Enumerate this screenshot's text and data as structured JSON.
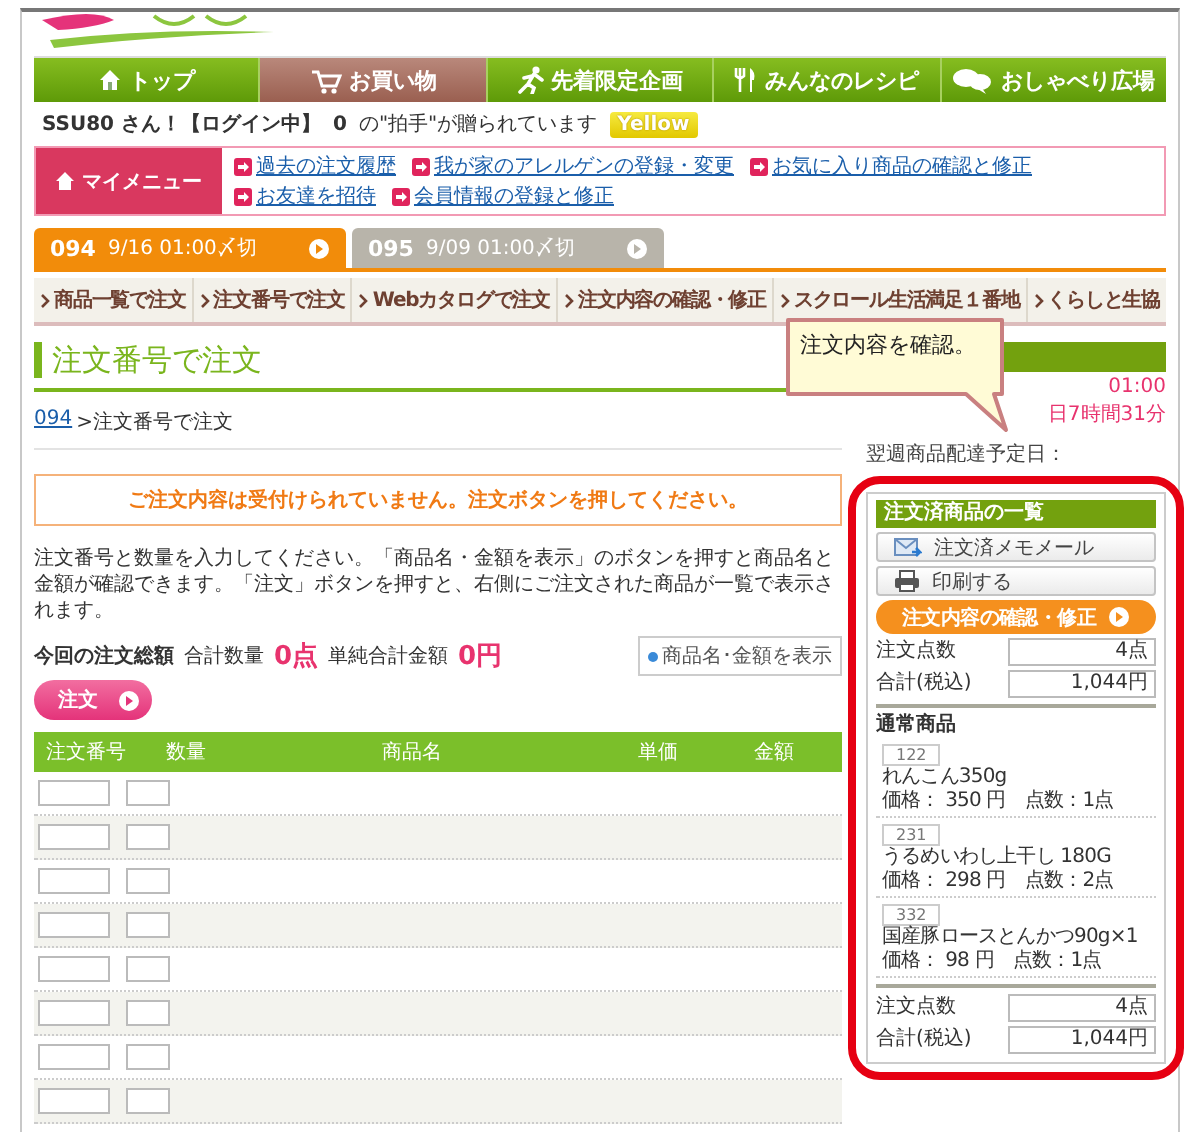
{
  "header": {
    "nav": [
      {
        "label": "トップ",
        "selected": false
      },
      {
        "label": "お買い物",
        "selected": true
      },
      {
        "label": "先着限定企画",
        "selected": false
      },
      {
        "label": "みんなのレシピ",
        "selected": false
      },
      {
        "label": "おしゃべり広場",
        "selected": false
      }
    ],
    "user": {
      "name": "SSU80 さん！【ログイン中】",
      "count": "0",
      "applause": "の\"拍手\"が贈られています",
      "rank": "Yellow"
    },
    "my_menu": {
      "label": "マイメニュー",
      "links": [
        "過去の注文履歴",
        "我が家のアレルゲンの登録・変更",
        "お気に入り商品の確認と修正",
        "お友達を招待",
        "会員情報の登録と修正"
      ]
    }
  },
  "order_tabs": [
    {
      "number": "094",
      "deadline": "9/16 01:00〆切",
      "selected": true
    },
    {
      "number": "095",
      "deadline": "9/09 01:00〆切",
      "selected": false
    }
  ],
  "subnav": [
    "商品一覧で注文",
    "注文番号で注文",
    "Webカタログで注文",
    "注文内容の確認・修正",
    "スクロール生活満足１番地",
    "くらしと生協"
  ],
  "main": {
    "heading": "注文番号で注文",
    "breadcrumb": {
      "link": "094",
      "current": ">注文番号で注文"
    },
    "notice": "ご注文内容は受付けられていません。注文ボタンを押してください。",
    "description": "注文番号と数量を入力してください。「商品名・金額を表示」のボタンを押すと商品名と金額が確認できます。「注文」ボタンを押すと、右側にご注文された商品が一覧で表示されます。",
    "totals": {
      "label": "今回の注文総額",
      "qty_label": "合計数量",
      "qty": "0点",
      "amount_label": "単純合計金額",
      "amount": "0円",
      "show_button": "商品名･金額を表示",
      "order_button": "注文"
    },
    "table": {
      "columns": [
        "注文番号",
        "数量",
        "商品名",
        "単価",
        "金額"
      ],
      "rows": [
        {
          "kind": "entry"
        },
        {
          "kind": "entry"
        },
        {
          "kind": "entry"
        },
        {
          "kind": "entry"
        },
        {
          "kind": "entry"
        },
        {
          "kind": "entry"
        },
        {
          "kind": "entry"
        },
        {
          "kind": "entry"
        }
      ]
    }
  },
  "side": {
    "deadline_time": "01:00",
    "remaining": "日7時間31分",
    "delivery_label": "翌週商品配達予定日：",
    "ordered": {
      "title": "注文済商品の一覧",
      "memo_button": "注文済メモメール",
      "print_button": "印刷する",
      "confirm_button": "注文内容の確認・修正",
      "summary_top": [
        {
          "label": "注文点数",
          "value": "4点"
        },
        {
          "label": "合計(税込)",
          "value": "1,044円"
        }
      ],
      "section": "通常商品",
      "items": [
        {
          "code": "122",
          "name": "れんこん350g",
          "price": "価格： 350 円　点数：1点"
        },
        {
          "code": "231",
          "name": "うるめいわし上干し 180G",
          "price": "価格： 298 円　点数：2点"
        },
        {
          "code": "332",
          "name": "国産豚ロースとんかつ90g×1",
          "price": "価格： 98 円　点数：1点"
        }
      ],
      "summary_bottom": [
        {
          "label": "注文点数",
          "value": "4点"
        },
        {
          "label": "合計(税込)",
          "value": "1,044円"
        }
      ]
    }
  },
  "callout": "注文内容を確認。"
}
